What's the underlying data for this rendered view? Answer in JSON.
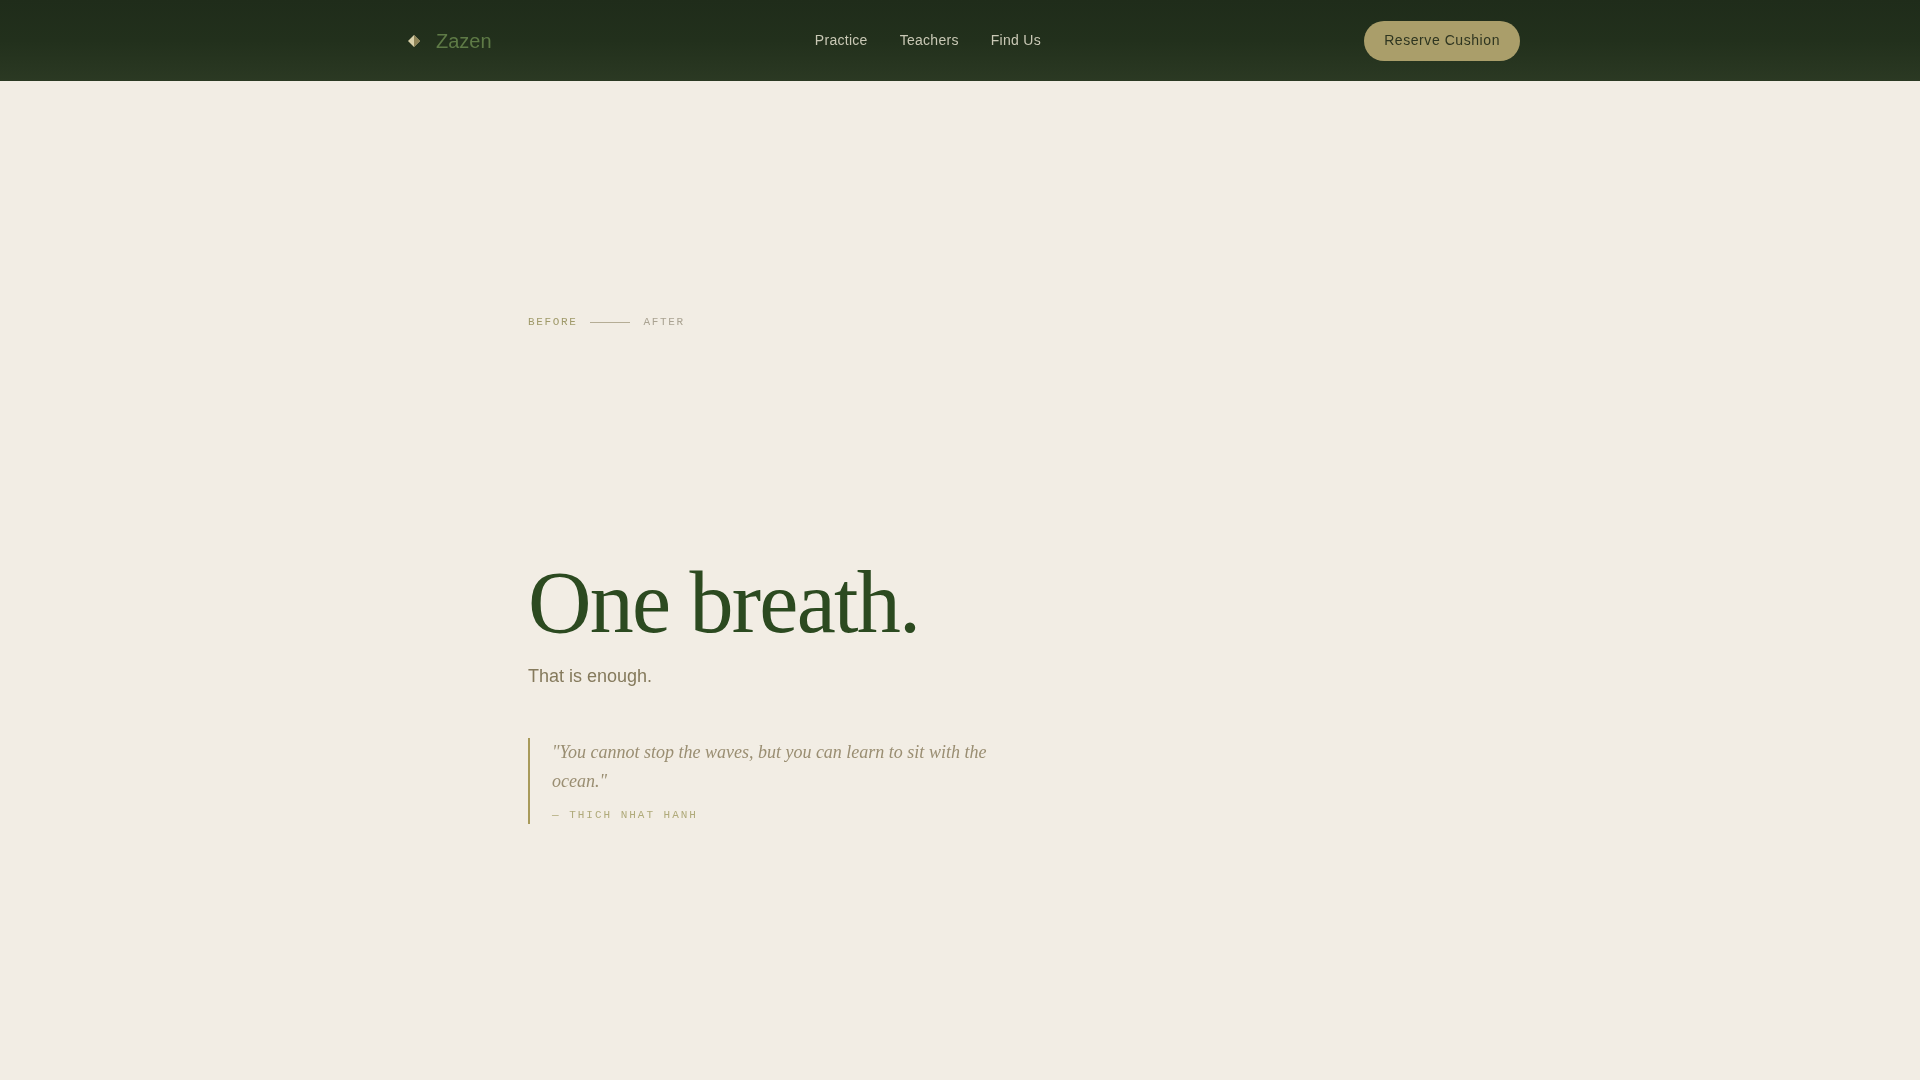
{
  "header": {
    "logo": {
      "text": "Zazen"
    },
    "nav": [
      {
        "label": "Practice"
      },
      {
        "label": "Teachers"
      },
      {
        "label": "Find Us"
      }
    ],
    "cta": "Reserve Cushion"
  },
  "hero": {
    "timeline": {
      "start": "BEFORE",
      "end": "AFTER"
    },
    "headline": "One breath.",
    "subtitle": "That is enough.",
    "quote": {
      "text": "\"You cannot stop the waves, but you can learn to sit with the ocean.\"",
      "attribution": "— THICH NHAT HANH"
    }
  }
}
